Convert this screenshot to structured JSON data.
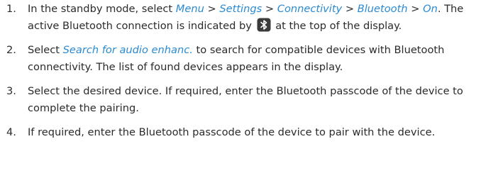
{
  "steps": [
    {
      "number": "1.",
      "text_a": "In the standby mode, select ",
      "menu": "Menu",
      "sep1": " > ",
      "settings": "Settings",
      "sep2": " > ",
      "connectivity": "Connectivity",
      "sep3": " > ",
      "bluetooth": "Bluetooth",
      "sep4": " > ",
      "on": "On",
      "text_b": ". The active Bluetooth connection is indicated by ",
      "icon": "bluetooth-icon",
      "text_c": " at the top of the display."
    },
    {
      "number": "2.",
      "text_a": "Select ",
      "search": "Search for audio enhanc.",
      "text_b": " to search for compatible devices with Bluetooth connectivity. The list of found devices appears in the display."
    },
    {
      "number": "3.",
      "text": "Select the desired device. If required, enter the Bluetooth passcode of the device to complete the pairing."
    },
    {
      "number": "4.",
      "text": "If required, enter the Bluetooth passcode of the device to pair with the device."
    }
  ],
  "colors": {
    "link": "#2a8ad2",
    "text": "#2b2b2b"
  }
}
